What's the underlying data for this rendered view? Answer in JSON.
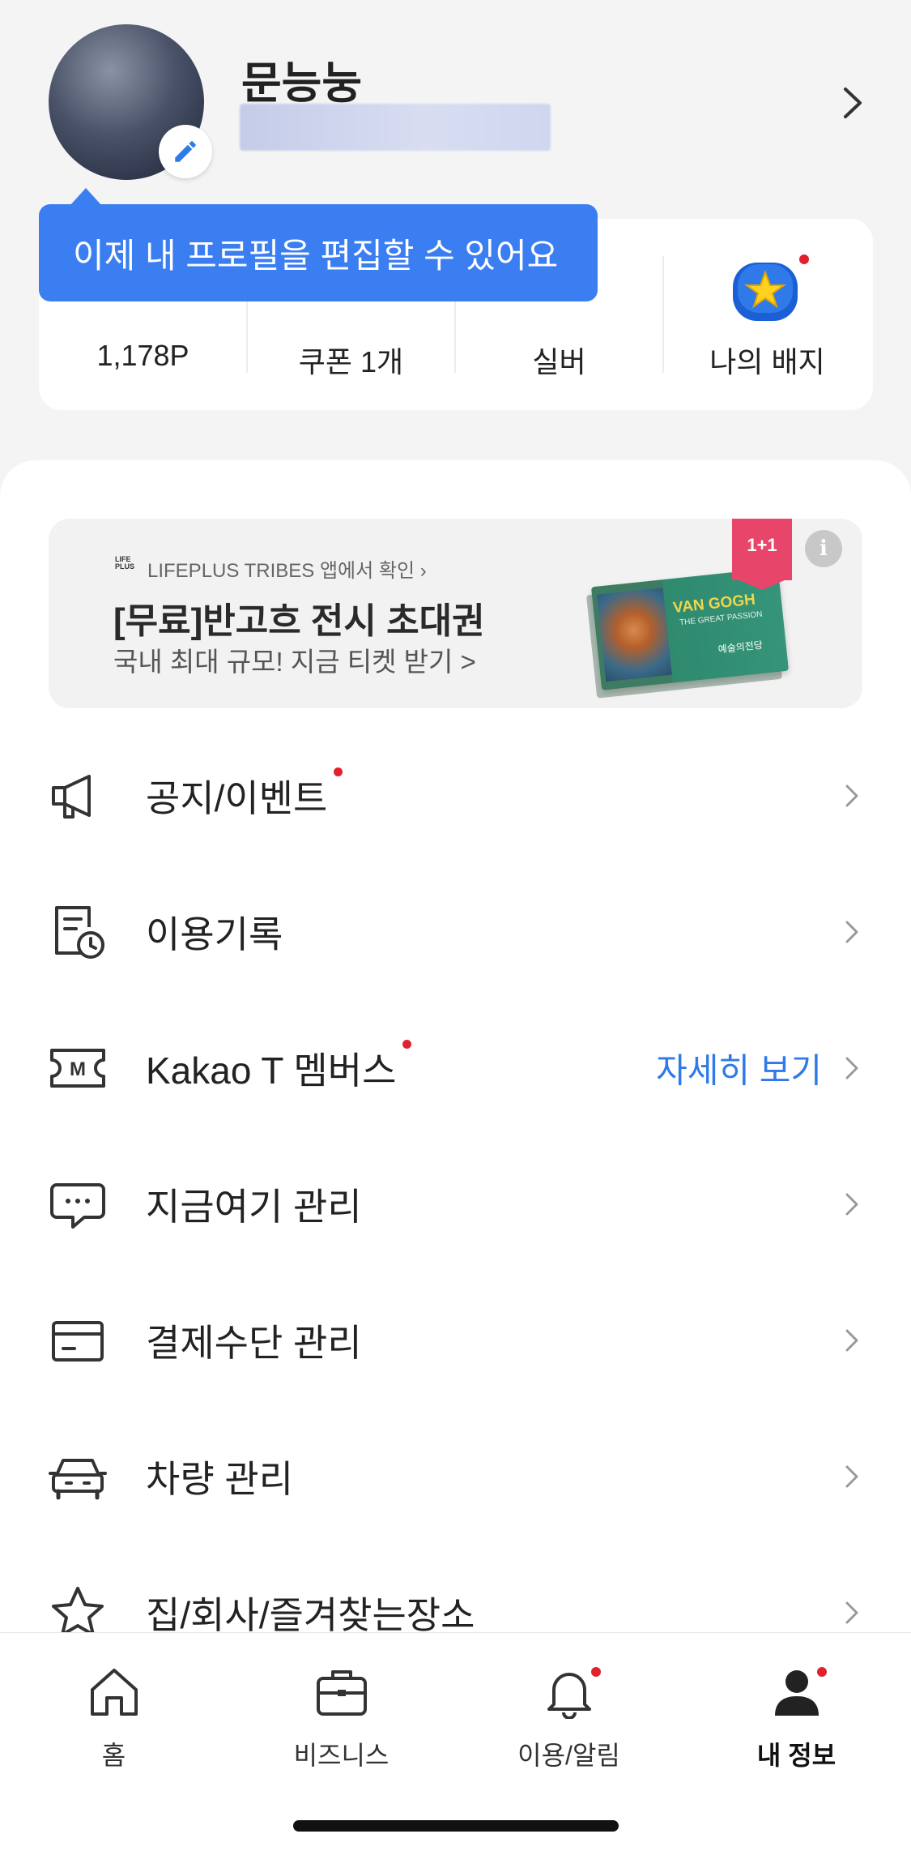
{
  "profile": {
    "name": "문능눙",
    "tooltip": "이제 내 프로필을 편집할 수 있어요"
  },
  "stats": [
    {
      "label": "1,178P",
      "icon": "point-coin-icon"
    },
    {
      "label": "쿠폰 1개",
      "icon": "coupon-icon"
    },
    {
      "label": "실버",
      "icon": "grade-silver-icon"
    },
    {
      "label": "나의 배지",
      "icon": "star-badge-icon"
    }
  ],
  "banner": {
    "logo": "LIFE PLUS",
    "source": "LIFEPLUS TRIBES 앱에서 확인 ›",
    "title": "[무료]반고흐 전시 초대권",
    "subtitle": "국내 최대 규모! 지금 티켓 받기 >",
    "badge": "1+1",
    "ticket_title": "VAN GOGH",
    "ticket_subtitle": "THE GREAT PASSION",
    "ticket_venue": "예술의전당"
  },
  "menu": [
    {
      "label": "공지/이벤트",
      "icon": "megaphone-icon",
      "dot": true,
      "action": ""
    },
    {
      "label": "이용기록",
      "icon": "history-icon",
      "dot": false,
      "action": ""
    },
    {
      "label": "Kakao T 멤버스",
      "icon": "membership-icon",
      "dot": true,
      "action": "자세히 보기"
    },
    {
      "label": "지금여기 관리",
      "icon": "chat-bubble-icon",
      "dot": false,
      "action": ""
    },
    {
      "label": "결제수단 관리",
      "icon": "card-icon",
      "dot": false,
      "action": ""
    },
    {
      "label": "차량 관리",
      "icon": "car-icon",
      "dot": false,
      "action": ""
    },
    {
      "label": "집/회사/즐겨찾는장소",
      "icon": "star-icon",
      "dot": false,
      "action": ""
    }
  ],
  "nav": [
    {
      "label": "홈",
      "icon": "home-icon",
      "active": false,
      "dot": false
    },
    {
      "label": "비즈니스",
      "icon": "briefcase-icon",
      "active": false,
      "dot": false
    },
    {
      "label": "이용/알림",
      "icon": "bell-icon",
      "active": false,
      "dot": true
    },
    {
      "label": "내 정보",
      "icon": "person-icon",
      "active": true,
      "dot": true
    }
  ],
  "colors": {
    "accent": "#3a7ef1",
    "link": "#2f7ae8",
    "notification_dot": "#e0222e",
    "promo": "#e8456a"
  }
}
